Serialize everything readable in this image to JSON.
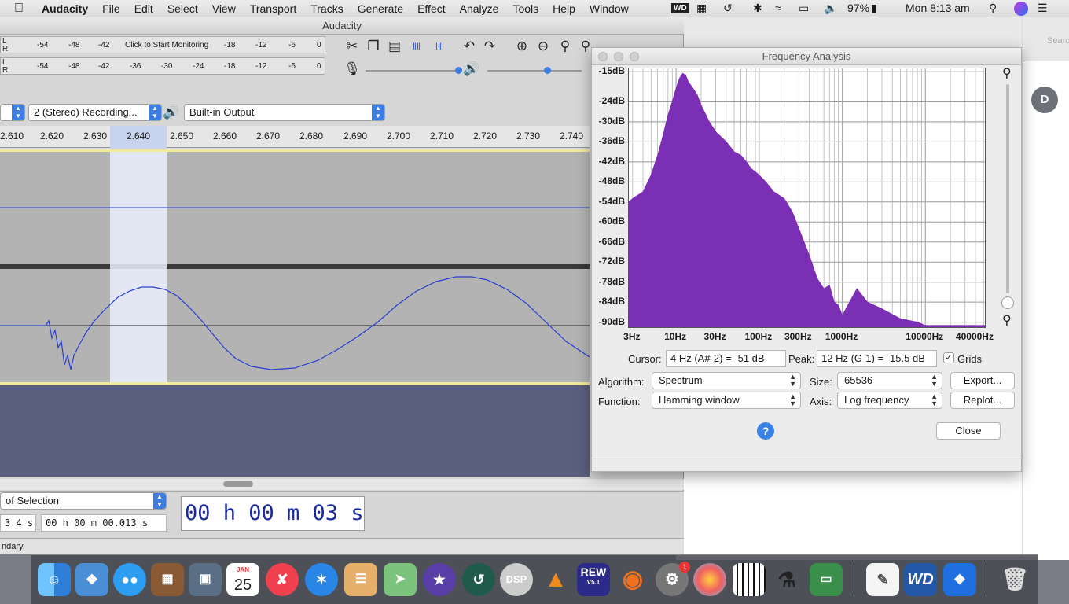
{
  "menubar": {
    "app": "Audacity",
    "items": [
      "File",
      "Edit",
      "Select",
      "View",
      "Transport",
      "Tracks",
      "Generate",
      "Effect",
      "Analyze",
      "Tools",
      "Help",
      "Window"
    ],
    "battery": "97%",
    "clock": "Mon 8:13 am"
  },
  "audacity": {
    "title": "Audacity",
    "meter_hint": "Click to Start Monitoring",
    "meter_ticks_top": [
      "-54",
      "-48",
      "-42",
      "-18",
      "-12",
      "-6",
      "0"
    ],
    "meter_ticks_bottom": [
      "-54",
      "-48",
      "-42",
      "-36",
      "-30",
      "-24",
      "-18",
      "-12",
      "-6",
      "0"
    ],
    "lr": [
      "L",
      "R"
    ],
    "recording_channels": "2 (Stereo) Recording...",
    "output_device": "Built-in Output",
    "ruler": [
      "2.610",
      "2.620",
      "2.630",
      "2.640",
      "2.650",
      "2.660",
      "2.670",
      "2.680",
      "2.690",
      "2.700",
      "2.710",
      "2.720",
      "2.730",
      "2.740"
    ],
    "selection_mode": "of Selection",
    "sel_start_tail": "3 4 s",
    "sel_end": "00 h 00 m 00.013 s",
    "time_display": "00 h 00 m 03 s",
    "status": "ndary."
  },
  "freq_analysis": {
    "title": "Frequency Analysis",
    "cursor_label": "Cursor:",
    "cursor_value": "4 Hz (A#-2) = -51 dB",
    "peak_label": "Peak:",
    "peak_value": "12 Hz (G-1) = -15.5 dB",
    "grids_label": "Grids",
    "grids_checked": true,
    "algorithm_label": "Algorithm:",
    "algorithm_value": "Spectrum",
    "size_label": "Size:",
    "size_value": "65536",
    "function_label": "Function:",
    "function_value": "Hamming window",
    "axis_label": "Axis:",
    "axis_value": "Log frequency",
    "export_label": "Export...",
    "replot_label": "Replot...",
    "close_label": "Close",
    "help_glyph": "?"
  },
  "chart_data": {
    "type": "area",
    "ytick_labels": [
      "-15dB",
      "-24dB",
      "-30dB",
      "-36dB",
      "-42dB",
      "-48dB",
      "-54dB",
      "-60dB",
      "-66dB",
      "-72dB",
      "-78dB",
      "-84dB",
      "-90dB"
    ],
    "xtick_labels": [
      "3Hz",
      "10Hz",
      "30Hz",
      "100Hz",
      "300Hz",
      "1000Hz",
      "10000Hz",
      "40000Hz"
    ],
    "x_scale": "log",
    "xlim": [
      2.7,
      52000
    ],
    "ylim": [
      -91.5,
      -14
    ],
    "grid": true,
    "color": "#7b2fb4",
    "x": [
      2.7,
      3,
      4,
      5,
      6,
      7,
      8,
      9,
      10,
      11,
      12,
      13,
      14,
      16,
      18,
      20,
      25,
      30,
      40,
      50,
      60,
      70,
      80,
      90,
      100,
      120,
      150,
      200,
      250,
      300,
      400,
      500,
      600,
      700,
      800,
      900,
      1000,
      1500,
      2000,
      3000,
      5000,
      8000,
      10000,
      20000,
      40000,
      52000
    ],
    "y": [
      -54,
      -53,
      -51,
      -46,
      -40,
      -34,
      -28,
      -24,
      -20,
      -17,
      -15.5,
      -16,
      -18,
      -20,
      -22,
      -25,
      -30,
      -33,
      -36,
      -39,
      -40,
      -42,
      -44,
      -45,
      -46,
      -48,
      -51,
      -53,
      -57,
      -62,
      -70,
      -77,
      -80,
      -79,
      -84,
      -85,
      -88,
      -80,
      -84,
      -86,
      -89,
      -90,
      -91,
      -91,
      -91,
      -91
    ]
  },
  "dock": {
    "apps": [
      "Finder",
      "Preview",
      "Messages",
      "Calculator",
      "Image Capture",
      "Calendar",
      "News",
      "Safari",
      "Archive",
      "Maps",
      "iMovie",
      "Time Machine",
      "DSP",
      "VLC",
      "REW",
      "Audacity",
      "System Preferences",
      "Photos",
      "Piano",
      "Microscope",
      "Screen",
      "TextEdit",
      "WD",
      "Dropbox",
      "Trash"
    ],
    "calendar_month": "JAN",
    "calendar_day": "25",
    "rew_label": "REW",
    "rew_version": "V5.1",
    "wd_label": "WD",
    "dsp_label": "DSP",
    "sysprefs_badge": "1"
  },
  "background": {
    "avatar": "D",
    "search_hint": "Searc"
  }
}
